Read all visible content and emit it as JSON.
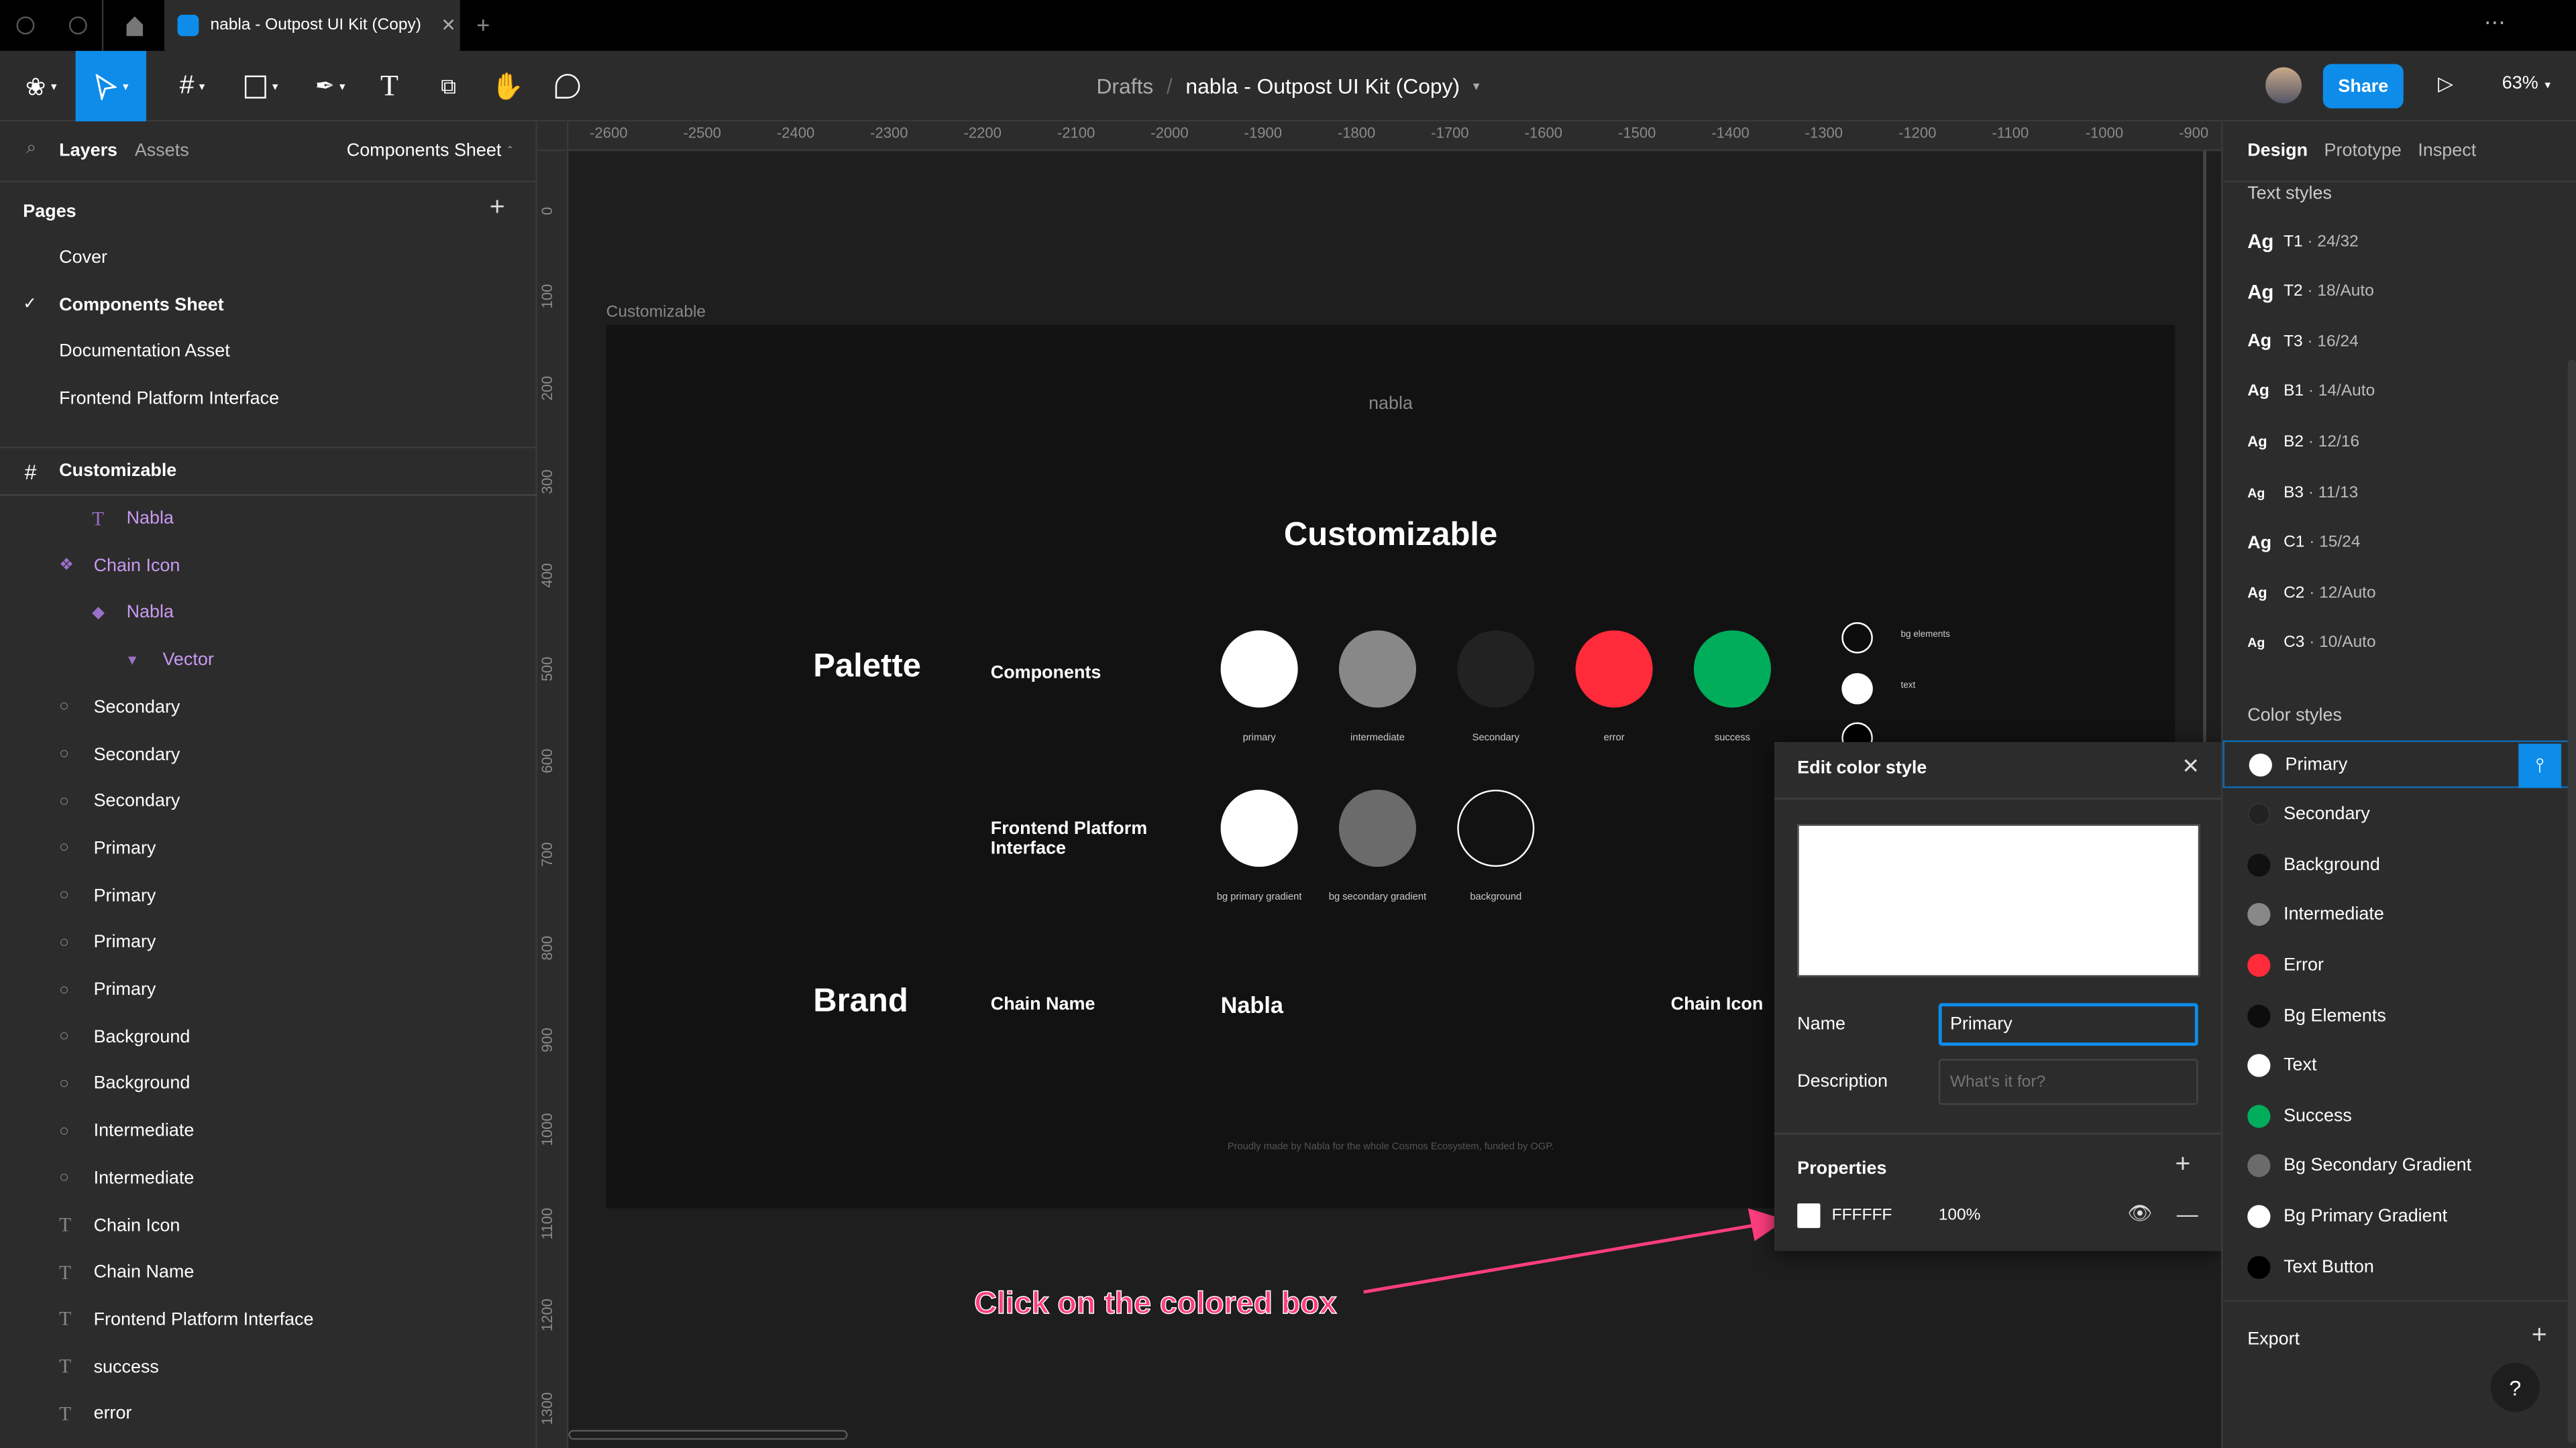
{
  "tab": {
    "title": "nabla - Outpost UI Kit (Copy)"
  },
  "header": {
    "breadcrumb_root": "Drafts",
    "separator": "/",
    "file_name": "nabla - Outpost UI Kit (Copy)",
    "share": "Share",
    "zoom": "63%"
  },
  "left": {
    "tab_layers": "Layers",
    "tab_assets": "Assets",
    "page_selector": "Components Sheet",
    "pages_title": "Pages",
    "pages": [
      {
        "label": "Cover"
      },
      {
        "label": "Components Sheet",
        "selected": true
      },
      {
        "label": "Documentation Asset"
      },
      {
        "label": "Frontend Platform Interface"
      }
    ],
    "frame": "Customizable",
    "layers": [
      {
        "label": "Nabla",
        "icon": "text",
        "indent": 2,
        "purple": true
      },
      {
        "label": "Chain Icon",
        "icon": "component",
        "indent": 1,
        "purple": true
      },
      {
        "label": "Nabla",
        "icon": "instance",
        "indent": 2,
        "purple": true
      },
      {
        "label": "Vector",
        "icon": "vector",
        "indent": 3,
        "purple": true
      },
      {
        "label": "Secondary",
        "icon": "ellipse",
        "indent": 1
      },
      {
        "label": "Secondary",
        "icon": "ellipse",
        "indent": 1
      },
      {
        "label": "Secondary",
        "icon": "ellipse",
        "indent": 1
      },
      {
        "label": "Primary",
        "icon": "ellipse",
        "indent": 1
      },
      {
        "label": "Primary",
        "icon": "ellipse",
        "indent": 1
      },
      {
        "label": "Primary",
        "icon": "ellipse",
        "indent": 1
      },
      {
        "label": "Primary",
        "icon": "ellipse",
        "indent": 1
      },
      {
        "label": "Background",
        "icon": "ellipse",
        "indent": 1
      },
      {
        "label": "Background",
        "icon": "ellipse",
        "indent": 1
      },
      {
        "label": "Intermediate",
        "icon": "ellipse",
        "indent": 1
      },
      {
        "label": "Intermediate",
        "icon": "ellipse",
        "indent": 1
      },
      {
        "label": "Chain Icon",
        "icon": "text",
        "indent": 1
      },
      {
        "label": "Chain Name",
        "icon": "text",
        "indent": 1
      },
      {
        "label": "Frontend Platform Interface",
        "icon": "text",
        "indent": 1
      },
      {
        "label": "success",
        "icon": "text",
        "indent": 1
      },
      {
        "label": "error",
        "icon": "text",
        "indent": 1
      }
    ]
  },
  "rulers": {
    "top": [
      "-2600",
      "-2500",
      "-2400",
      "-2300",
      "-2200",
      "-2100",
      "-2000",
      "-1900",
      "-1800",
      "-1700",
      "-1600",
      "-1500",
      "-1400",
      "-1300",
      "-1200",
      "-1100",
      "-1000",
      "-900"
    ],
    "left": [
      "0",
      "100",
      "200",
      "300",
      "400",
      "500",
      "600",
      "700",
      "800",
      "900",
      "1000",
      "1100",
      "1200",
      "1300"
    ]
  },
  "canvas": {
    "frame_label": "Customizable",
    "logo": "nabla",
    "title": "Customizable",
    "palette": "Palette",
    "components": "Components",
    "swatches": [
      {
        "label": "primary",
        "color": "#ffffff"
      },
      {
        "label": "intermediate",
        "color": "#888888"
      },
      {
        "label": "Secondary",
        "color": "#222222"
      },
      {
        "label": "error",
        "color": "#ff2a3a"
      },
      {
        "label": "success",
        "color": "#00ad5a"
      }
    ],
    "small_swatches": [
      {
        "label": "bg elements",
        "color": "#0d0d0d",
        "outline": true
      },
      {
        "label": "text",
        "color": "#ffffff"
      },
      {
        "label": "",
        "color": "#000000",
        "outline": true
      }
    ],
    "fpi": "Frontend Platform Interface",
    "fpi_swatches": [
      {
        "label": "bg primary gradient",
        "color": "#ffffff"
      },
      {
        "label": "bg secondary gradient",
        "color": "#6b6b6b"
      },
      {
        "label": "background",
        "color": "#121212",
        "outline": true
      }
    ],
    "brand": "Brand",
    "chain_name": "Chain Name",
    "nabla": "Nabla",
    "chain_icon": "Chain Icon",
    "footer": "Proudly made by Nabla for the whole Cosmos Ecosystem, funded by OGP."
  },
  "dialog": {
    "title": "Edit color style",
    "preview_color": "#ffffff",
    "name_label": "Name",
    "name_value": "Primary",
    "desc_label": "Description",
    "desc_placeholder": "What's it for?",
    "properties": "Properties",
    "hex": "FFFFFF",
    "opacity": "100%"
  },
  "right": {
    "tabs": [
      "Design",
      "Prototype",
      "Inspect"
    ],
    "text_styles_title": "Text styles",
    "text_styles": [
      {
        "ag": "Ag",
        "name": "T1",
        "spec": " · 24/32",
        "size": 12
      },
      {
        "ag": "Ag",
        "name": "T2",
        "spec": " · 18/Auto",
        "size": 12
      },
      {
        "ag": "Ag",
        "name": "T3",
        "spec": " · 16/24",
        "size": 11
      },
      {
        "ag": "Ag",
        "name": "B1",
        "spec": " · 14/Auto",
        "size": 10
      },
      {
        "ag": "Ag",
        "name": "B2",
        "spec": " · 12/16",
        "size": 9
      },
      {
        "ag": "Ag",
        "name": "B3",
        "spec": " · 11/13",
        "size": 8
      },
      {
        "ag": "Ag",
        "name": "C1",
        "spec": " · 15/24",
        "size": 11
      },
      {
        "ag": "Ag",
        "name": "C2",
        "spec": " · 12/Auto",
        "size": 9
      },
      {
        "ag": "Ag",
        "name": "C3",
        "spec": " · 10/Auto",
        "size": 8
      }
    ],
    "color_styles_title": "Color styles",
    "color_styles": [
      {
        "name": "Primary",
        "color": "#ffffff"
      },
      {
        "name": "Secondary",
        "color": "#222222"
      },
      {
        "name": "Background",
        "color": "#111111"
      },
      {
        "name": "Intermediate",
        "color": "#888888"
      },
      {
        "name": "Error",
        "color": "#ff2a3a"
      },
      {
        "name": "Bg Elements",
        "color": "#0d0d0d"
      },
      {
        "name": "Text",
        "color": "#ffffff"
      },
      {
        "name": "Success",
        "color": "#00ad5a"
      },
      {
        "name": "Bg Secondary Gradient",
        "color": "#6b6b6b"
      },
      {
        "name": "Bg Primary Gradient",
        "color": "#ffffff"
      },
      {
        "name": "Text Button",
        "color": "#000000"
      }
    ],
    "export": "Export",
    "help": "?"
  },
  "annotation": {
    "text": "Click on the colored box",
    "color": "#ff3d7f"
  },
  "colors": {
    "accent": "#0d8ce9",
    "purple": "#c89af0"
  }
}
